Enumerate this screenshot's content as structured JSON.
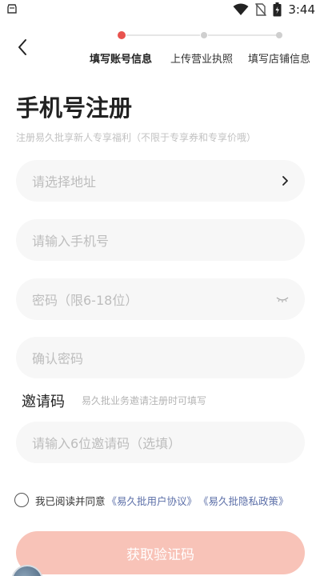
{
  "status_bar": {
    "time": "3:44",
    "icons": [
      "app-notification-icon",
      "wifi-icon",
      "no-sim-icon",
      "battery-icon"
    ]
  },
  "nav": {
    "back_icon": "chevron-left-icon"
  },
  "steps": [
    {
      "label": "填写账号信息",
      "active": true
    },
    {
      "label": "上传营业执照",
      "active": false
    },
    {
      "label": "填写店铺信息",
      "active": false
    }
  ],
  "colors": {
    "accent": "#e8534e",
    "inactive_dot": "#cfcfcf",
    "button_disabled": "#f8c3b8",
    "link": "#5c6fa8"
  },
  "header": {
    "title": "手机号注册",
    "subtitle": "注册易久批享新人专享福利（不限于专享券和专享价哦）"
  },
  "form": {
    "address_placeholder": "请选择地址",
    "phone_placeholder": "请输入手机号",
    "password_placeholder": "密码（限6-18位）",
    "confirm_placeholder": "确认密码",
    "invite_label": "邀请码",
    "invite_hint": "易久批业务邀请注册时可填写",
    "invite_placeholder": "请输入6位邀请码（选填）"
  },
  "agreement": {
    "text": "我已阅读并同意",
    "link_user": "《易久批用户协议》",
    "link_privacy": "《易久批隐私政策》",
    "checked": false
  },
  "submit": {
    "label": "获取验证码"
  }
}
